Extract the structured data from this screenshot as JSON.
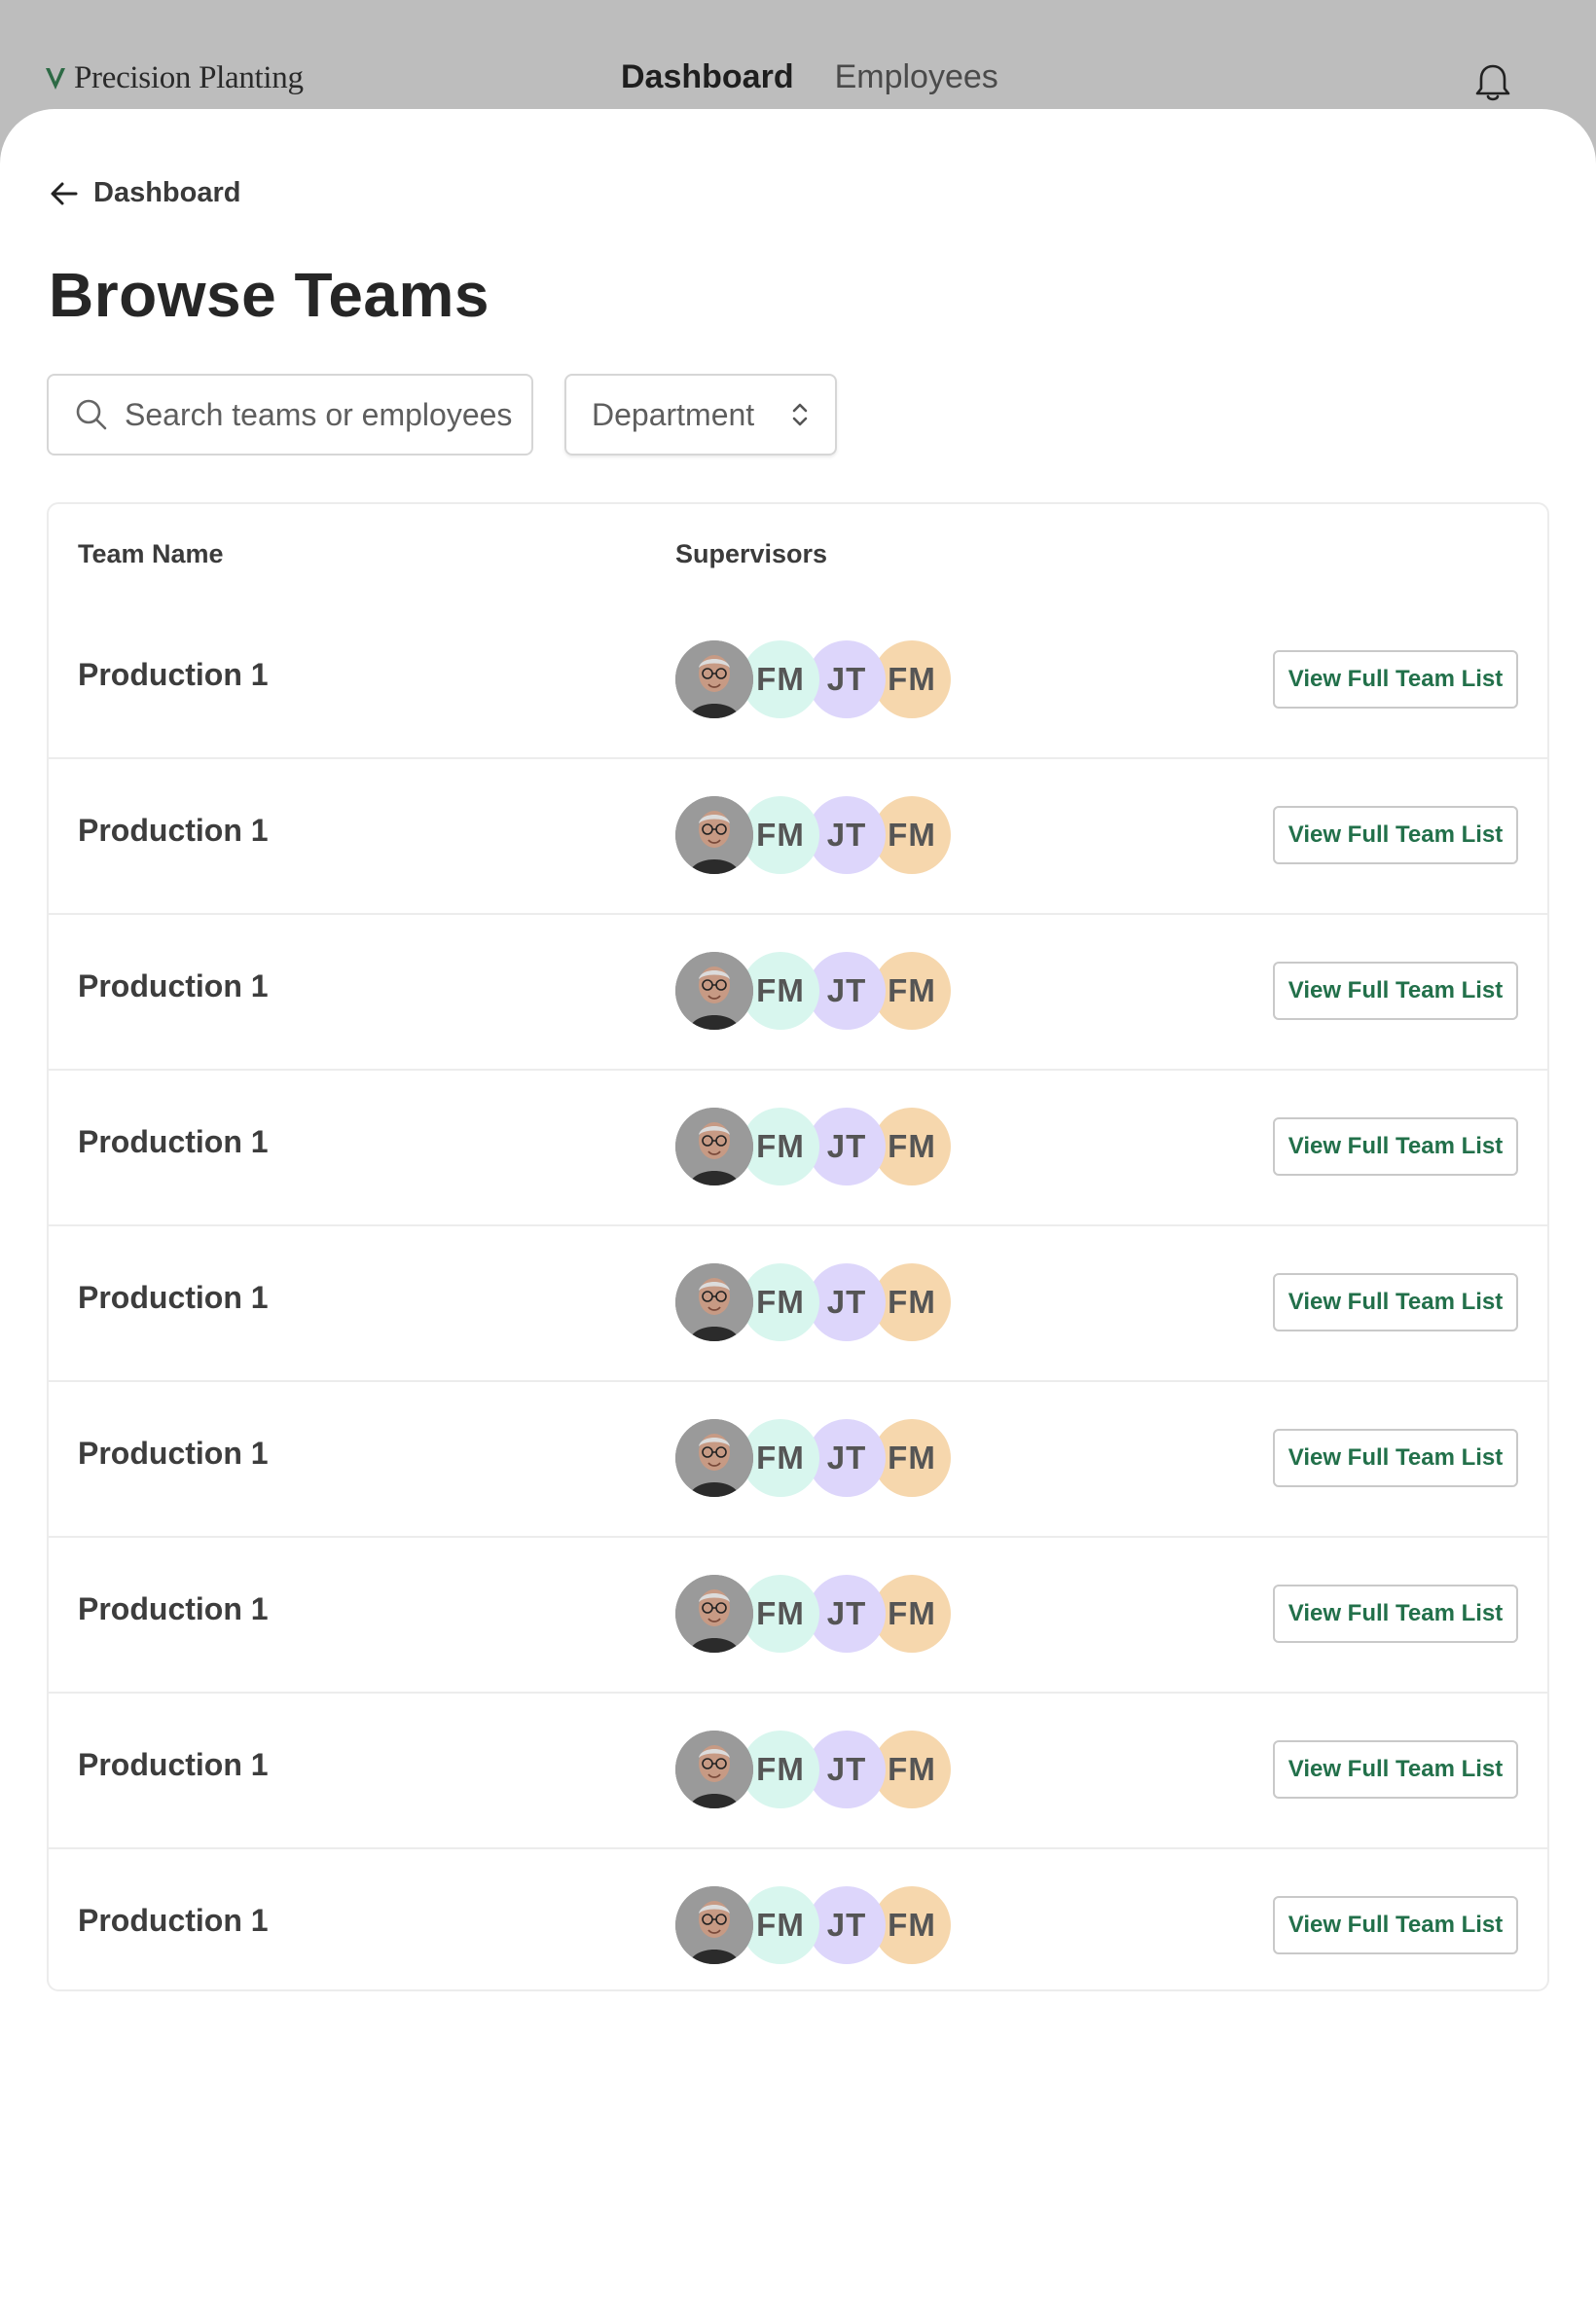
{
  "header": {
    "brand": "Precision Planting",
    "nav": [
      {
        "label": "Dashboard",
        "active": true
      },
      {
        "label": "Employees",
        "active": false
      }
    ],
    "notification_icon": "bell-icon"
  },
  "page": {
    "back_label": "Dashboard",
    "title": "Browse Teams"
  },
  "filters": {
    "search_placeholder": "Search teams or employees",
    "department_label": "Department"
  },
  "table": {
    "columns": [
      "Team Name",
      "Supervisors"
    ],
    "rows": [
      {
        "team": "Production 1",
        "supervisors": [
          "FM",
          "JT",
          "FM"
        ],
        "action": "View Full Team List"
      },
      {
        "team": "Production 1",
        "supervisors": [
          "FM",
          "JT",
          "FM"
        ],
        "action": "View Full Team List"
      },
      {
        "team": "Production 1",
        "supervisors": [
          "FM",
          "JT",
          "FM"
        ],
        "action": "View Full Team List"
      },
      {
        "team": "Production 1",
        "supervisors": [
          "FM",
          "JT",
          "FM"
        ],
        "action": "View Full Team List"
      },
      {
        "team": "Production 1",
        "supervisors": [
          "FM",
          "JT",
          "FM"
        ],
        "action": "View Full Team List"
      },
      {
        "team": "Production 1",
        "supervisors": [
          "FM",
          "JT",
          "FM"
        ],
        "action": "View Full Team List"
      },
      {
        "team": "Production 1",
        "supervisors": [
          "FM",
          "JT",
          "FM"
        ],
        "action": "View Full Team List"
      },
      {
        "team": "Production 1",
        "supervisors": [
          "FM",
          "JT",
          "FM"
        ],
        "action": "View Full Team List"
      },
      {
        "team": "Production 1",
        "supervisors": [
          "FM",
          "JT",
          "FM"
        ],
        "action": "View Full Team List"
      }
    ]
  },
  "colors": {
    "accent_green": "#22704a",
    "avatar_mint": "#d8f6ee",
    "avatar_lavender": "#ddd6fb",
    "avatar_peach": "#f6d7ad"
  }
}
